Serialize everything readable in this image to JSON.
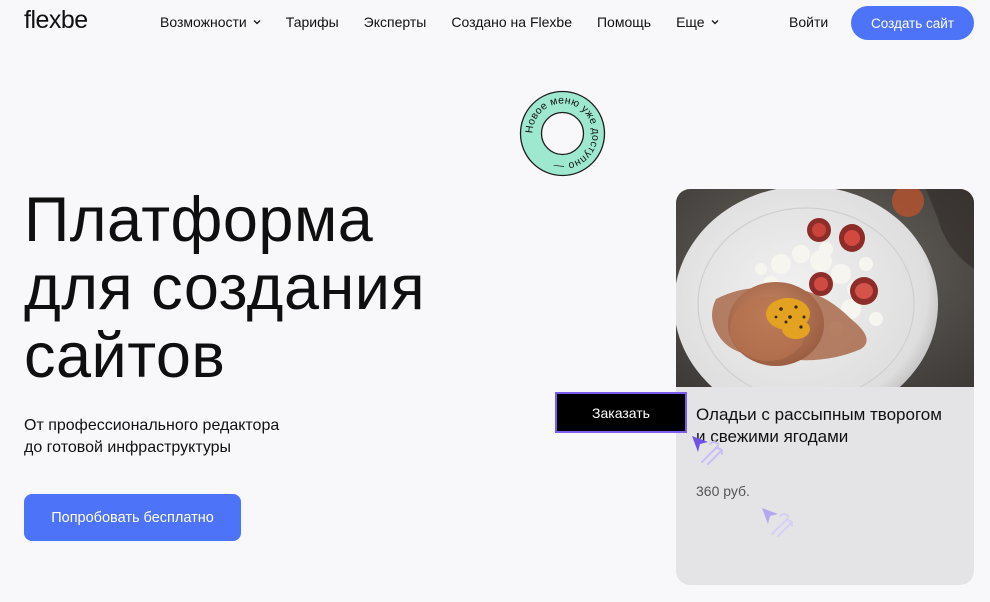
{
  "header": {
    "logo": "flexbe",
    "nav": [
      {
        "label": "Возможности",
        "has_dropdown": true
      },
      {
        "label": "Тарифы",
        "has_dropdown": false
      },
      {
        "label": "Эксперты",
        "has_dropdown": false
      },
      {
        "label": "Создано на Flexbe",
        "has_dropdown": false
      },
      {
        "label": "Помощь",
        "has_dropdown": false
      },
      {
        "label": "Еще",
        "has_dropdown": true
      }
    ],
    "login": "Войти",
    "create_site": "Создать сайт"
  },
  "stamp": {
    "text": "Новое меню уже доступно —"
  },
  "hero": {
    "title_lines": [
      "Платформа",
      "для создания",
      "сайтов"
    ],
    "subtitle_lines": [
      "От профессионального редактора",
      "до готовой инфраструктуры"
    ],
    "cta": "Попробовать бесплатно"
  },
  "card": {
    "title": "Оладьи с рассыпным творогом и свежими ягодами",
    "price": "360 руб.",
    "order_button": "Заказать"
  },
  "colors": {
    "accent": "#4d73f8",
    "background": "#f8f8fa",
    "card_bg": "#e4e4e6",
    "stamp_bg": "#9fe8d0",
    "cursor": "#7b5cf0"
  }
}
